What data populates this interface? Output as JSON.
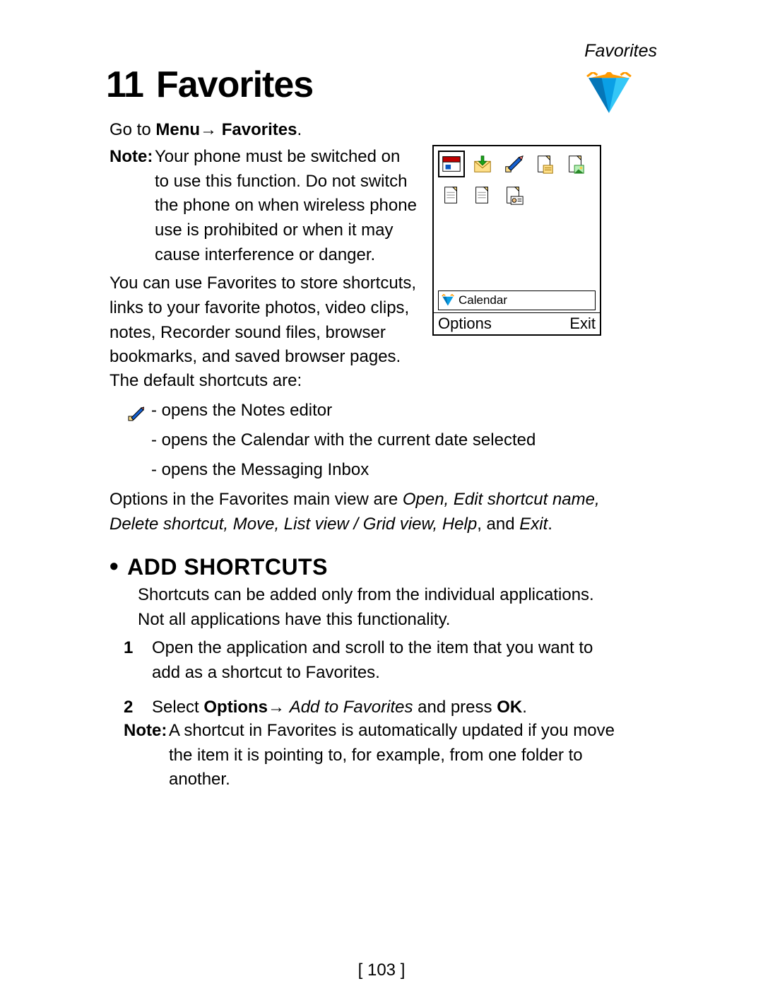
{
  "running_head": "Favorites",
  "chapter": {
    "number": "11",
    "title": "Favorites"
  },
  "goto": {
    "prefix": "Go to ",
    "menu": "Menu",
    "arrow": "→",
    "target": "Favorites",
    "suffix": "."
  },
  "note1": {
    "label": "Note:",
    "body": "Your phone must be switched on to use this function. Do not switch the phone on when wireless phone use is prohibited or when it may cause interference or danger."
  },
  "intro_para": "You can use Favorites to store shortcuts, links to your favorite photos, video clips, notes, Recorder sound files, browser bookmarks, and saved browser pages.",
  "defaults_line": "The default shortcuts are:",
  "defaults": [
    " - opens the Notes editor",
    " - opens the Calendar with the current date selected",
    " - opens the Messaging Inbox"
  ],
  "options_sentence": {
    "lead": "Options in the Favorites main view are ",
    "items_italic": "Open, Edit shortcut name, Delete shortcut, Move, List view / Grid view, Help",
    "tail_plain": ", and ",
    "tail_italic": "Exit",
    "end": "."
  },
  "section": {
    "heading": "ADD SHORTCUTS",
    "para": "Shortcuts can be added only from the individual applications. Not all applications have this functionality.",
    "steps": [
      {
        "n": "1",
        "text": "Open the application and scroll to the item that you want to add as a shortcut to Favorites."
      },
      {
        "n": "2",
        "select": "Select ",
        "options": "Options",
        "arrow": "→ ",
        "addto": "Add to Favorites",
        "mid": " and press ",
        "ok": "OK",
        "end": "."
      }
    ],
    "note": {
      "label": "Note:",
      "body": "A shortcut in Favorites is automatically updated if you move the item it is pointing to, for example, from one folder to another."
    }
  },
  "page_number": "[ 103 ]",
  "phone": {
    "selected_label": "Calendar",
    "left_softkey": "Options",
    "right_softkey": "Exit",
    "icons": [
      "today-icon",
      "inbox-icon",
      "notes-icon",
      "note-page-icon",
      "photo-page-icon",
      "page-icon",
      "page-icon",
      "card-page-icon"
    ]
  },
  "icons": {
    "gem_big": "favorites-gem-icon",
    "gem_small": "favorites-gem-icon",
    "pencil": "notes-pencil-icon"
  }
}
